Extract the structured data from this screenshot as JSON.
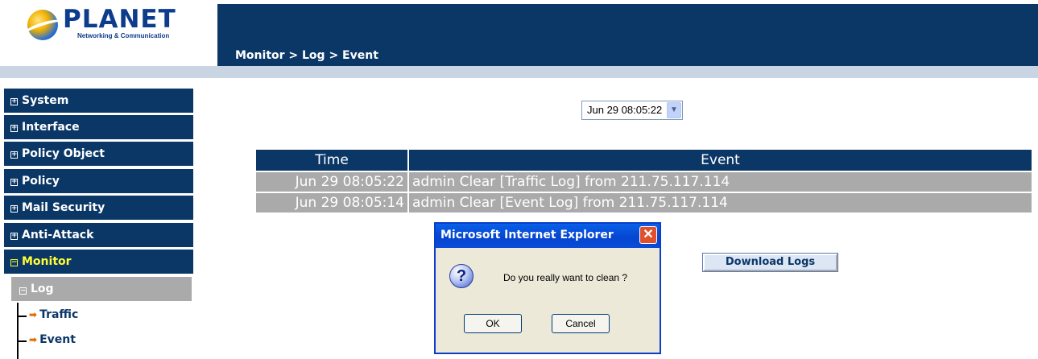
{
  "header": {
    "logo_text": "PLANET",
    "logo_sub": "Networking & Communication",
    "breadcrumb": "Monitor > Log > Event"
  },
  "sidebar": {
    "items": [
      {
        "label": "System"
      },
      {
        "label": "Interface"
      },
      {
        "label": "Policy Object"
      },
      {
        "label": "Policy"
      },
      {
        "label": "Mail Security"
      },
      {
        "label": "Anti-Attack"
      },
      {
        "label": "Monitor"
      }
    ],
    "submenu": {
      "label": "Log",
      "children": [
        {
          "label": "Traffic"
        },
        {
          "label": "Event"
        }
      ]
    }
  },
  "filter": {
    "selected_time": "Jun 29 08:05:22"
  },
  "table": {
    "headers": [
      "Time",
      "Event"
    ],
    "rows": [
      {
        "time": "Jun 29 08:05:22",
        "event": "admin Clear [Traffic Log] from 211.75.117.114"
      },
      {
        "time": "Jun 29 08:05:14",
        "event": "admin Clear [Event Log] from 211.75.117.114"
      }
    ]
  },
  "download_label": "Download Logs",
  "dialog": {
    "title": "Microsoft Internet Explorer",
    "message": "Do you really want to clean ?",
    "ok_label": "OK",
    "cancel_label": "Cancel"
  },
  "colors": {
    "nav_bg": "#0b3767",
    "active_text": "#ffff33",
    "row_bg": "#aaaaaa"
  }
}
